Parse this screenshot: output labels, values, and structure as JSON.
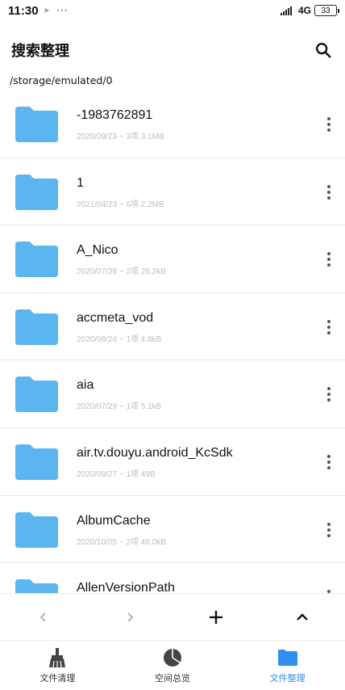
{
  "status_bar": {
    "time": "11:30",
    "dots": "···",
    "network": "4G",
    "battery": "33"
  },
  "header": {
    "title": "搜索整理"
  },
  "path": "/storage/emulated/0",
  "files": [
    {
      "name": "-1983762891",
      "meta": "2020/09/23 ~ 3项 3.1MB"
    },
    {
      "name": "1",
      "meta": "2021/04/23 ~ 6项 2.2MB"
    },
    {
      "name": "A_Nico",
      "meta": "2020/07/29 ~ 2项 28.2kB"
    },
    {
      "name": "accmeta_vod",
      "meta": "2020/08/24 ~ 1项 4.8kB"
    },
    {
      "name": "aia",
      "meta": "2020/07/29 ~ 1项 5.1kB"
    },
    {
      "name": "air.tv.douyu.android_KcSdk",
      "meta": "2020/09/27 ~ 1项 49B"
    },
    {
      "name": "AlbumCache",
      "meta": "2020/10/05 ~ 2项 46.0kB"
    },
    {
      "name": "AllenVersionPath",
      "meta": ""
    }
  ],
  "toolbar": {
    "back_icon": "chevron-left-icon",
    "forward_icon": "chevron-right-icon",
    "add_icon": "plus-icon",
    "up_icon": "chevron-up-icon"
  },
  "tabs": [
    {
      "label": "文件清理",
      "icon": "broom-icon"
    },
    {
      "label": "空间总览",
      "icon": "pie-chart-icon"
    },
    {
      "label": "文件整理",
      "icon": "folder-icon",
      "active": true
    }
  ],
  "colors": {
    "folder": "#5bb5ee",
    "accent": "#2f8ff0",
    "meta_text": "#bdbdbd"
  }
}
